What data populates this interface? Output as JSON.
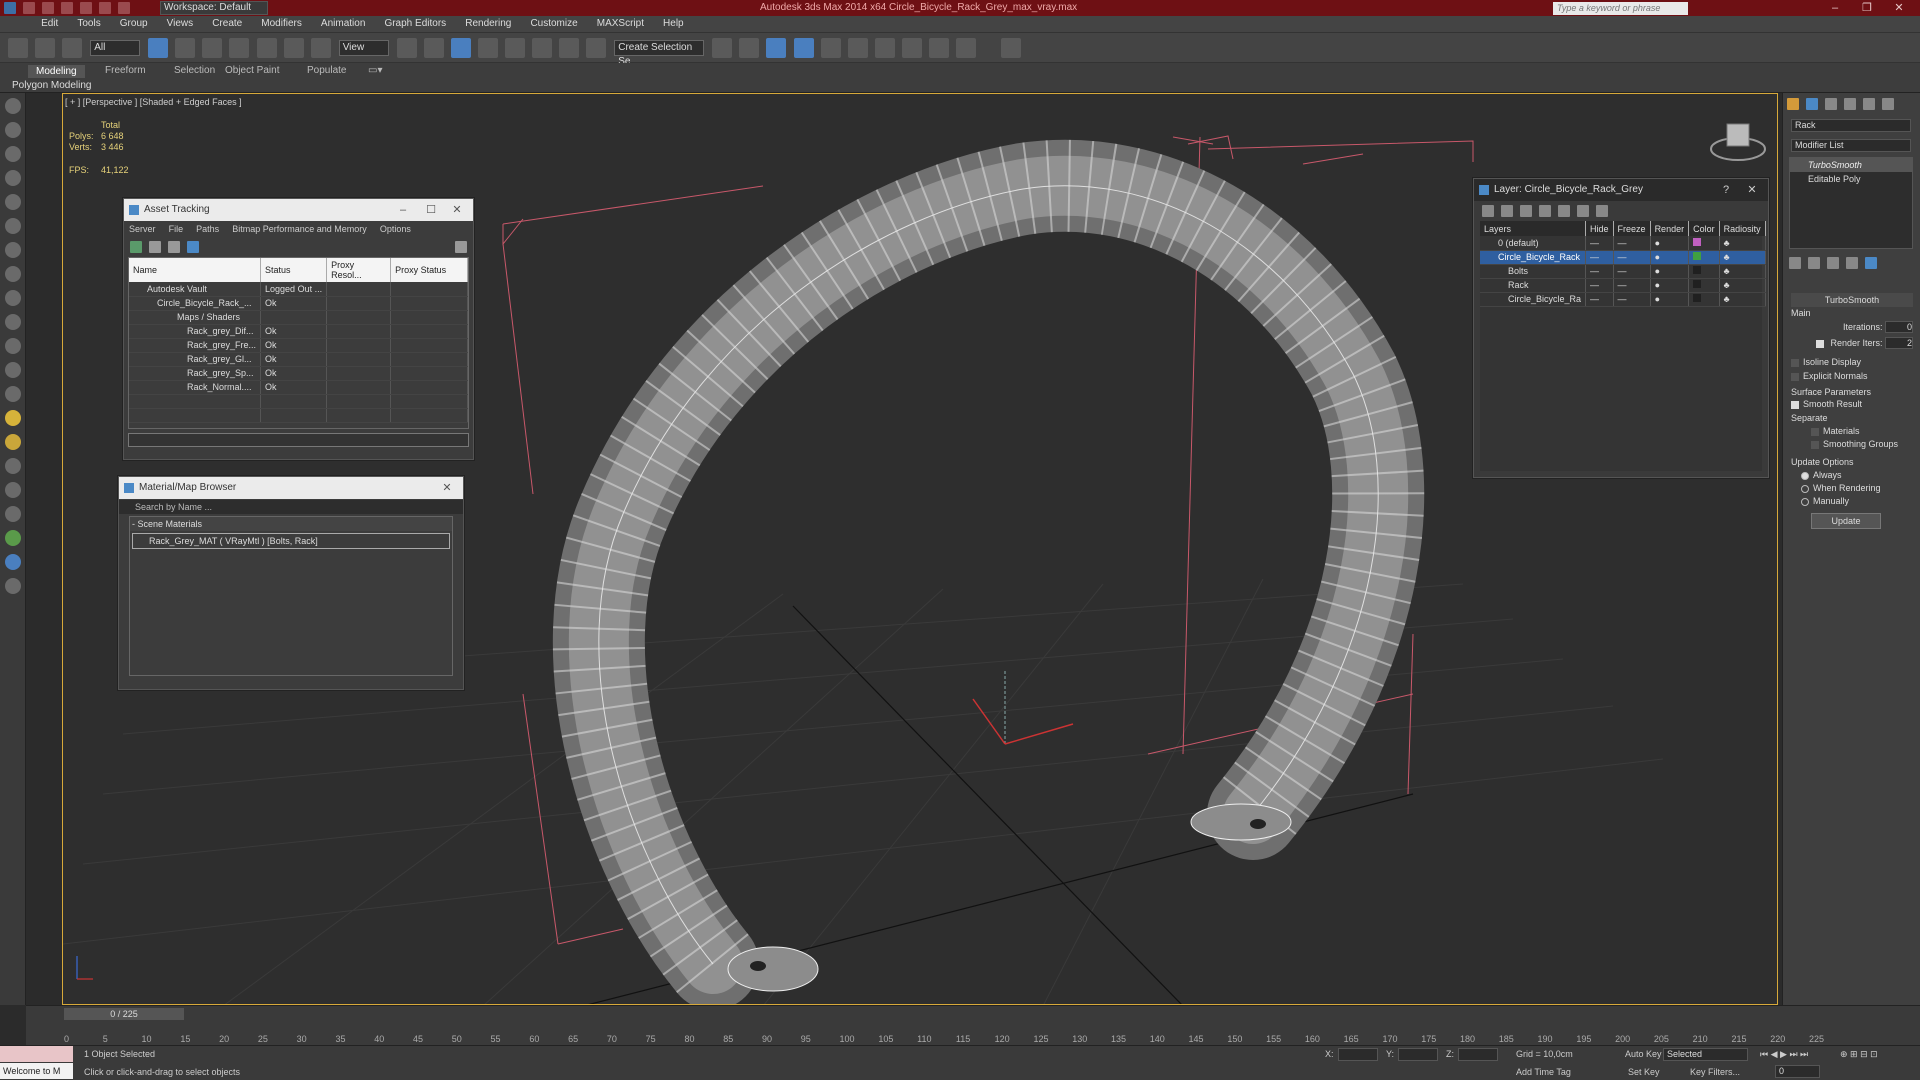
{
  "titlebar": {
    "title": "Autodesk 3ds Max  2014 x64     Circle_Bicycle_Rack_Grey_max_vray.max",
    "workspace": "Workspace: Default",
    "search_placeholder": "Type a keyword or phrase"
  },
  "menu": [
    "Edit",
    "Tools",
    "Group",
    "Views",
    "Create",
    "Modifiers",
    "Animation",
    "Graph Editors",
    "Rendering",
    "Customize",
    "MAXScript",
    "Help"
  ],
  "toolbar": {
    "filter": "All",
    "refcoord": "View",
    "selection_set": "Create Selection Se"
  },
  "ribbon": {
    "tabs": [
      "Modeling",
      "Freeform",
      "Selection",
      "Object Paint",
      "Populate"
    ],
    "subtab": "Polygon Modeling"
  },
  "viewport": {
    "label": "[ + ] [Perspective ] [Shaded + Edged Faces ]",
    "stats": {
      "total": "Total",
      "polys_label": "Polys:",
      "polys": "6 648",
      "verts_label": "Verts:",
      "verts": "3 446",
      "fps_label": "FPS:",
      "fps": "41,122"
    }
  },
  "asset_tracking": {
    "title": "Asset Tracking",
    "menu": [
      "Server",
      "File",
      "Paths",
      "Bitmap Performance and Memory",
      "Options"
    ],
    "columns": [
      "Name",
      "Status",
      "Proxy Resol...",
      "Proxy Status"
    ],
    "rows": [
      {
        "name": "Autodesk Vault",
        "status": "Logged Out ..."
      },
      {
        "name": "Circle_Bicycle_Rack_...",
        "status": "Ok"
      },
      {
        "name": "Maps / Shaders",
        "status": ""
      },
      {
        "name": "Rack_grey_Dif...",
        "status": "Ok"
      },
      {
        "name": "Rack_grey_Fre...",
        "status": "Ok"
      },
      {
        "name": "Rack_grey_Gl...",
        "status": "Ok"
      },
      {
        "name": "Rack_grey_Sp...",
        "status": "Ok"
      },
      {
        "name": "Rack_Normal....",
        "status": "Ok"
      }
    ]
  },
  "material_browser": {
    "title": "Material/Map Browser",
    "search_placeholder": "Search by Name ...",
    "group": "- Scene Materials",
    "item": "Rack_Grey_MAT  ( VRayMtl )  [Bolts, Rack]"
  },
  "layer_panel": {
    "title": "Layer: Circle_Bicycle_Rack_Grey",
    "columns": [
      "Layers",
      "Hide",
      "Freeze",
      "Render",
      "Color",
      "Radiosity"
    ],
    "rows": [
      {
        "name": "0 (default)",
        "color": "#c060c0"
      },
      {
        "name": "Circle_Bicycle_Rack",
        "color": "#40a040"
      },
      {
        "name": "Bolts",
        "color": "#202020"
      },
      {
        "name": "Rack",
        "color": "#202020"
      },
      {
        "name": "Circle_Bicycle_Ra",
        "color": "#202020"
      }
    ]
  },
  "command_panel": {
    "object_name": "Rack",
    "modifier_list": "Modifier List",
    "stack": [
      "TurboSmooth",
      "Editable Poly"
    ],
    "rollout": "TurboSmooth",
    "main": "Main",
    "iterations_label": "Iterations:",
    "iterations": "0",
    "render_iters_label": "Render Iters:",
    "render_iters": "2",
    "isoline": "Isoline Display",
    "explicit_normals": "Explicit Normals",
    "surface_params": "Surface Parameters",
    "smooth_result": "Smooth Result",
    "separate": "Separate",
    "materials": "Materials",
    "smoothing_groups": "Smoothing Groups",
    "update_options": "Update Options",
    "always": "Always",
    "when_rendering": "When Rendering",
    "manually": "Manually",
    "update": "Update"
  },
  "timeline": {
    "frame": "0 / 225",
    "ticks": [
      "0",
      "5",
      "10",
      "15",
      "20",
      "25",
      "30",
      "35",
      "40",
      "45",
      "50",
      "55",
      "60",
      "65",
      "70",
      "75",
      "80",
      "85",
      "90",
      "95",
      "100",
      "105",
      "110",
      "115",
      "120",
      "125",
      "130",
      "135",
      "140",
      "145",
      "150",
      "155",
      "160",
      "165",
      "170",
      "175",
      "180",
      "185",
      "190",
      "195",
      "200",
      "205",
      "210",
      "215",
      "220",
      "225"
    ]
  },
  "status": {
    "welcome": "Welcome to M",
    "selected": "1 Object Selected",
    "hint": "Click or click-and-drag to select objects",
    "x": "X:",
    "y": "Y:",
    "z": "Z:",
    "grid": "Grid = 10,0cm",
    "add_time_tag": "Add Time Tag",
    "auto_key": "Auto Key",
    "selected_mode": "Selected",
    "set_key": "Set Key",
    "key_filters": "Key Filters...",
    "frame_field": "0"
  },
  "colors": {
    "title_bg": "#6e1014",
    "viewport_border": "#d7a93a",
    "accent": "#4b89c6",
    "stat_text": "#e6d27a"
  }
}
